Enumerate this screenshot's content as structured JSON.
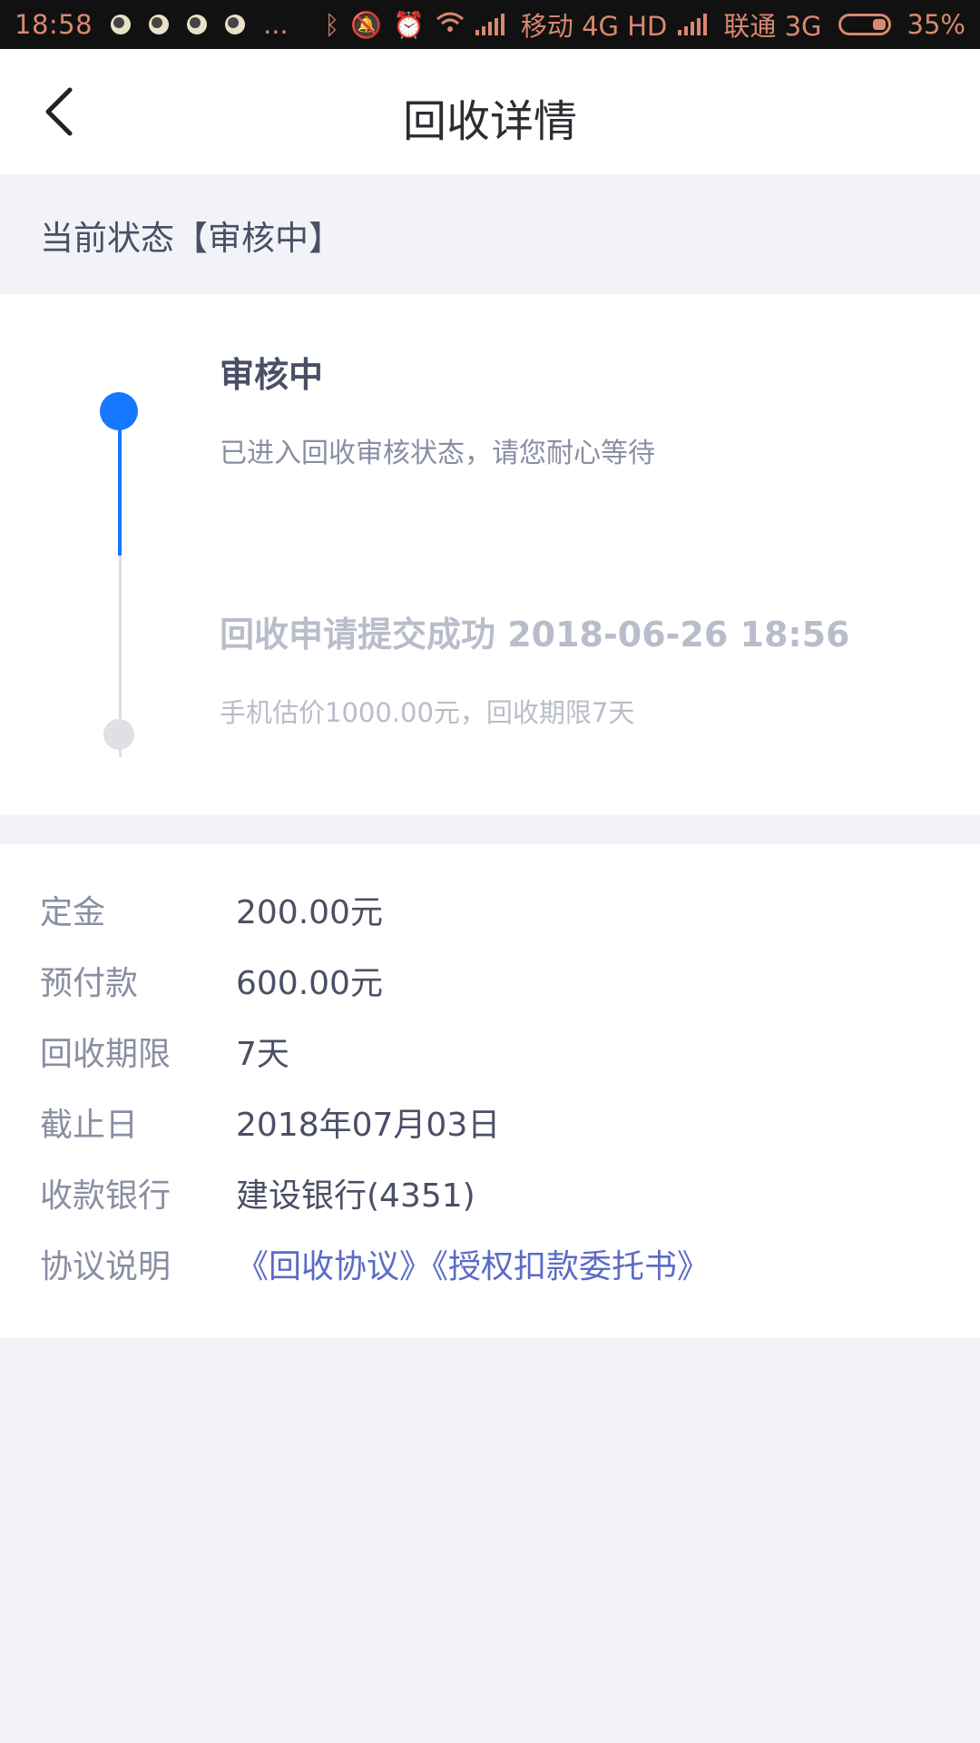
{
  "status_bar": {
    "time": "18:58",
    "more": "...",
    "carrier1": "移动 4G HD",
    "carrier2": "联通 3G",
    "battery": "35%"
  },
  "header": {
    "title": "回收详情"
  },
  "current_status": {
    "text": "当前状态【审核中】"
  },
  "timeline": {
    "steps": [
      {
        "title": "审核中",
        "desc": "已进入回收审核状态，请您耐心等待"
      },
      {
        "title": "回收申请提交成功 2018-06-26 18:56",
        "desc": "手机估价1000.00元，回收期限7天"
      }
    ]
  },
  "details": {
    "rows": [
      {
        "label": "定金",
        "value": "200.00元"
      },
      {
        "label": "预付款",
        "value": "600.00元"
      },
      {
        "label": "回收期限",
        "value": "7天"
      },
      {
        "label": "截止日",
        "value": "2018年07月03日"
      },
      {
        "label": "收款银行",
        "value": "建设银行(4351)"
      },
      {
        "label": "协议说明",
        "links": [
          "《回收协议》",
          "《授权扣款委托书》"
        ]
      }
    ]
  },
  "colors": {
    "accent": "#1677ff",
    "link": "#5b6bc6",
    "background": "#f2f3f8"
  }
}
